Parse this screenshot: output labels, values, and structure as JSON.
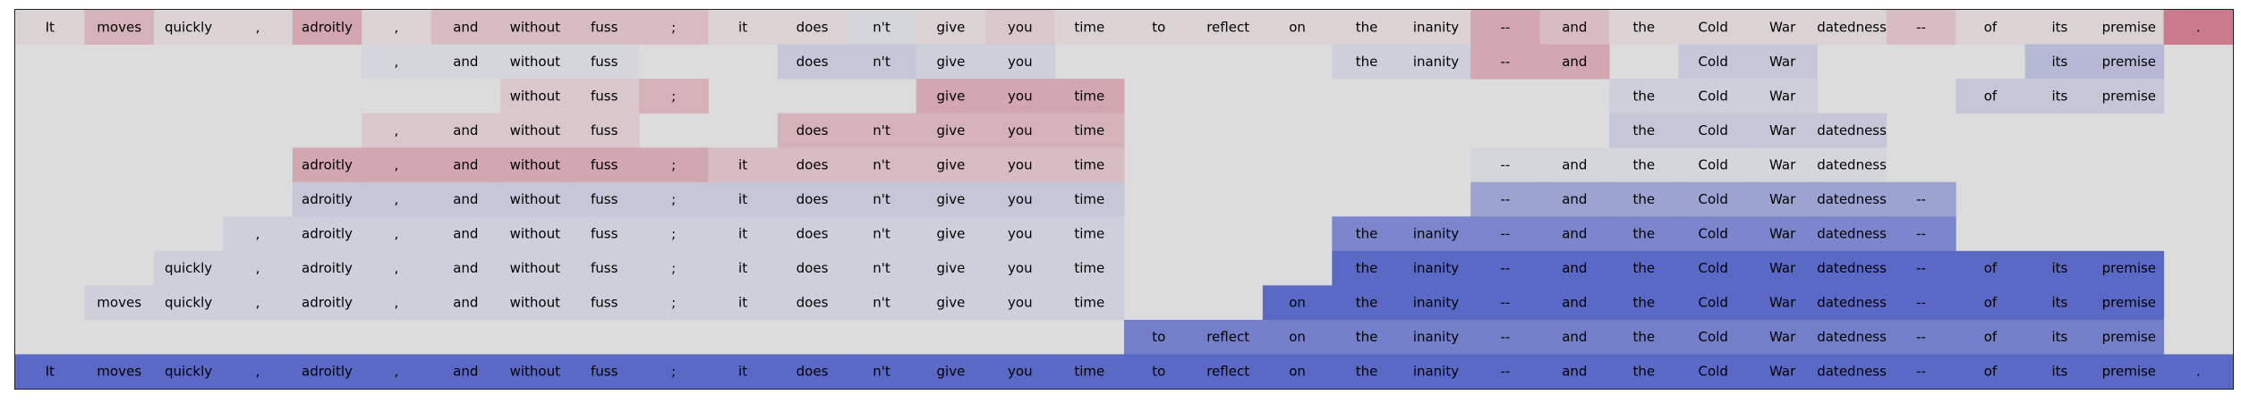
{
  "chart_data": {
    "type": "heatmap",
    "title": "",
    "xlabel": "",
    "ylabel": "",
    "background_color": "#dcdcdc",
    "tokens": [
      "It",
      "moves",
      "quickly",
      ",",
      "adroitly",
      ",",
      "and",
      "without",
      "fuss",
      ";",
      "it",
      "does",
      "n't",
      "give",
      "you",
      "time",
      "to",
      "reflect",
      "on",
      "the",
      "inanity",
      "--",
      "and",
      "the",
      "Cold",
      "War",
      "datedness",
      "--",
      "of",
      "its",
      "premise",
      "."
    ],
    "rows": [
      {
        "spans": [
          {
            "start": 0,
            "end": 31,
            "values": [
              0.05,
              0.2,
              0.05,
              0.05,
              0.25,
              0.05,
              0.15,
              0.15,
              0.15,
              0.15,
              0.05,
              0.05,
              -0.05,
              0.05,
              0.1,
              0.05,
              0.05,
              0.05,
              0.05,
              0.05,
              0.05,
              0.25,
              0.15,
              0.05,
              0.05,
              0.05,
              0.05,
              0.15,
              0.05,
              0.05,
              0.05,
              0.45
            ]
          }
        ]
      },
      {
        "spans": [
          {
            "start": 5,
            "end": 8,
            "values": [
              -0.05,
              -0.05,
              -0.05,
              -0.05
            ]
          },
          {
            "start": 11,
            "end": 14,
            "values": [
              -0.15,
              -0.15,
              -0.1,
              -0.1
            ]
          },
          {
            "start": 19,
            "end": 22,
            "values": [
              -0.1,
              -0.1,
              0.25,
              0.25
            ]
          },
          {
            "start": 24,
            "end": 25,
            "values": [
              -0.15,
              -0.15
            ]
          },
          {
            "start": 29,
            "end": 30,
            "values": [
              -0.25,
              -0.25
            ]
          }
        ]
      },
      {
        "spans": [
          {
            "start": 7,
            "end": 9,
            "values": [
              0.1,
              0.1,
              0.2
            ]
          },
          {
            "start": 13,
            "end": 15,
            "values": [
              0.25,
              0.25,
              0.25
            ]
          },
          {
            "start": 23,
            "end": 25,
            "values": [
              -0.1,
              -0.1,
              -0.1
            ]
          },
          {
            "start": 28,
            "end": 30,
            "values": [
              -0.15,
              -0.15,
              -0.15
            ]
          }
        ]
      },
      {
        "spans": [
          {
            "start": 5,
            "end": 8,
            "values": [
              0.1,
              0.1,
              0.1,
              0.1
            ]
          },
          {
            "start": 11,
            "end": 15,
            "values": [
              0.2,
              0.2,
              0.2,
              0.2,
              0.2
            ]
          },
          {
            "start": 23,
            "end": 26,
            "values": [
              -0.15,
              -0.15,
              -0.15,
              -0.15
            ]
          }
        ]
      },
      {
        "spans": [
          {
            "start": 4,
            "end": 9,
            "values": [
              0.25,
              0.25,
              0.25,
              0.25,
              0.25,
              0.25
            ]
          },
          {
            "start": 10,
            "end": 15,
            "values": [
              0.15,
              0.15,
              0.15,
              0.15,
              0.15,
              0.15
            ]
          },
          {
            "start": 21,
            "end": 26,
            "values": [
              -0.05,
              -0.05,
              -0.05,
              -0.05,
              -0.05,
              -0.05
            ]
          }
        ]
      },
      {
        "spans": [
          {
            "start": 4,
            "end": 15,
            "values": [
              -0.15,
              -0.15,
              -0.15,
              -0.15,
              -0.15,
              -0.15,
              -0.15,
              -0.15,
              -0.15,
              -0.15,
              -0.15,
              -0.15
            ]
          },
          {
            "start": 21,
            "end": 27,
            "values": [
              -0.4,
              -0.4,
              -0.4,
              -0.4,
              -0.4,
              -0.4,
              -0.4
            ]
          }
        ]
      },
      {
        "spans": [
          {
            "start": 3,
            "end": 15,
            "values": [
              -0.1,
              -0.1,
              -0.1,
              -0.1,
              -0.1,
              -0.1,
              -0.1,
              -0.1,
              -0.1,
              -0.1,
              -0.1,
              -0.1,
              -0.1
            ]
          },
          {
            "start": 19,
            "end": 27,
            "values": [
              -0.6,
              -0.6,
              -0.6,
              -0.6,
              -0.6,
              -0.6,
              -0.6,
              -0.6,
              -0.6
            ]
          }
        ]
      },
      {
        "spans": [
          {
            "start": 2,
            "end": 15,
            "values": [
              -0.1,
              -0.1,
              -0.1,
              -0.1,
              -0.1,
              -0.1,
              -0.1,
              -0.1,
              -0.1,
              -0.1,
              -0.1,
              -0.1,
              -0.1,
              -0.1
            ]
          },
          {
            "start": 19,
            "end": 30,
            "values": [
              -0.8,
              -0.8,
              -0.8,
              -0.8,
              -0.8,
              -0.8,
              -0.8,
              -0.8,
              -0.8,
              -0.8,
              -0.8,
              -0.8
            ]
          }
        ]
      },
      {
        "spans": [
          {
            "start": 1,
            "end": 15,
            "values": [
              -0.1,
              -0.1,
              -0.1,
              -0.1,
              -0.1,
              -0.1,
              -0.1,
              -0.1,
              -0.1,
              -0.1,
              -0.1,
              -0.1,
              -0.1,
              -0.1,
              -0.1
            ]
          },
          {
            "start": 18,
            "end": 30,
            "values": [
              -0.8,
              -0.8,
              -0.8,
              -0.8,
              -0.8,
              -0.8,
              -0.8,
              -0.8,
              -0.8,
              -0.8,
              -0.8,
              -0.8,
              -0.8
            ]
          }
        ]
      },
      {
        "spans": [
          {
            "start": 16,
            "end": 30,
            "values": [
              -0.65,
              -0.65,
              -0.65,
              -0.65,
              -0.65,
              -0.65,
              -0.65,
              -0.65,
              -0.65,
              -0.65,
              -0.65,
              -0.65,
              -0.65,
              -0.65,
              -0.65
            ]
          }
        ]
      },
      {
        "spans": [
          {
            "start": 0,
            "end": 31,
            "values": [
              -0.8,
              -0.8,
              -0.8,
              -0.8,
              -0.8,
              -0.8,
              -0.8,
              -0.8,
              -0.8,
              -0.8,
              -0.8,
              -0.8,
              -0.8,
              -0.8,
              -0.8,
              -0.8,
              -0.8,
              -0.8,
              -0.8,
              -0.8,
              -0.8,
              -0.8,
              -0.8,
              -0.8,
              -0.8,
              -0.8,
              -0.8,
              -0.8,
              -0.8,
              -0.8,
              -0.8,
              -0.8
            ]
          }
        ]
      }
    ]
  }
}
